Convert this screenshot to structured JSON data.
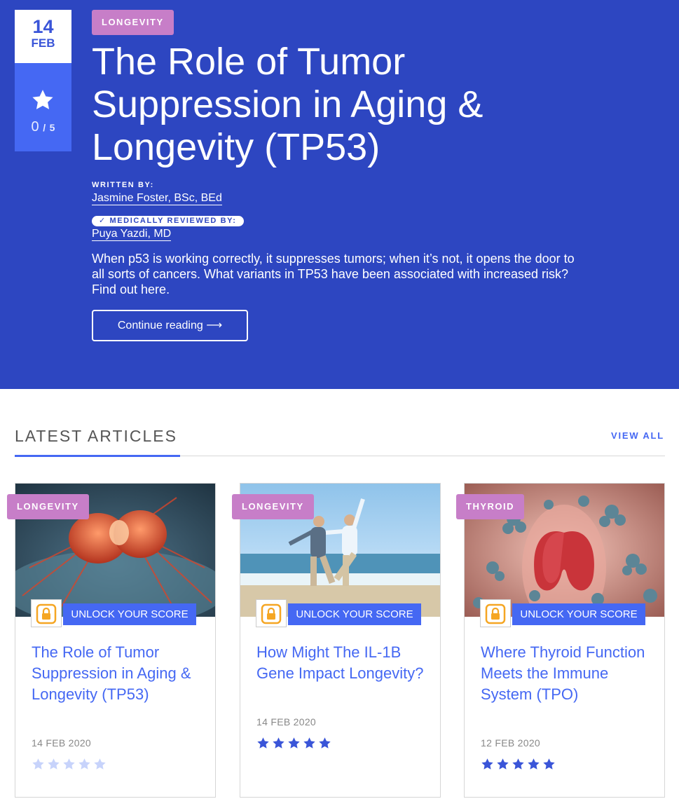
{
  "hero": {
    "date": {
      "day": "14",
      "month": "FEB"
    },
    "rating": {
      "value": "0",
      "slash": "/",
      "max": "5"
    },
    "category": "LONGEVITY",
    "title": "The Role of Tumor Suppression in Aging & Longevity (TP53)",
    "written_by_label": "WRITTEN BY:",
    "author": "Jasmine Foster, BSc, BEd",
    "reviewed_by_label": "✓ MEDICALLY REVIEWED BY:",
    "reviewer": "Puya Yazdi, MD",
    "description": "When p53 is working correctly, it suppresses tumors; when it’s not, it opens the door to all sorts of cancers. What variants in TP53 have been associated with increased risk? Find out here.",
    "continue_label": "Continue reading ⟶"
  },
  "latest": {
    "title": "LATEST ARTICLES",
    "view_all": "VIEW ALL",
    "unlock_label": "UNLOCK YOUR SCORE",
    "cards": [
      {
        "category": "LONGEVITY",
        "title": "The Role of Tumor Suppression in Aging & Longevity (TP53)",
        "date": "14 FEB 2020",
        "stars": 0
      },
      {
        "category": "LONGEVITY",
        "title": "How Might The IL-1B Gene Impact Longevity?",
        "date": "14 FEB 2020",
        "stars": 5
      },
      {
        "category": "THYROID",
        "title": "Where Thyroid Function Meets the Immune System (TPO)",
        "date": "12 FEB 2020",
        "stars": 5
      }
    ]
  },
  "colors": {
    "hero_bg": "#2d46c1",
    "accent": "#4568f3",
    "badge": "#c77ec8",
    "lock": "#f5a623",
    "star_filled": "#3a55d8",
    "star_empty": "#c7d3fb"
  }
}
